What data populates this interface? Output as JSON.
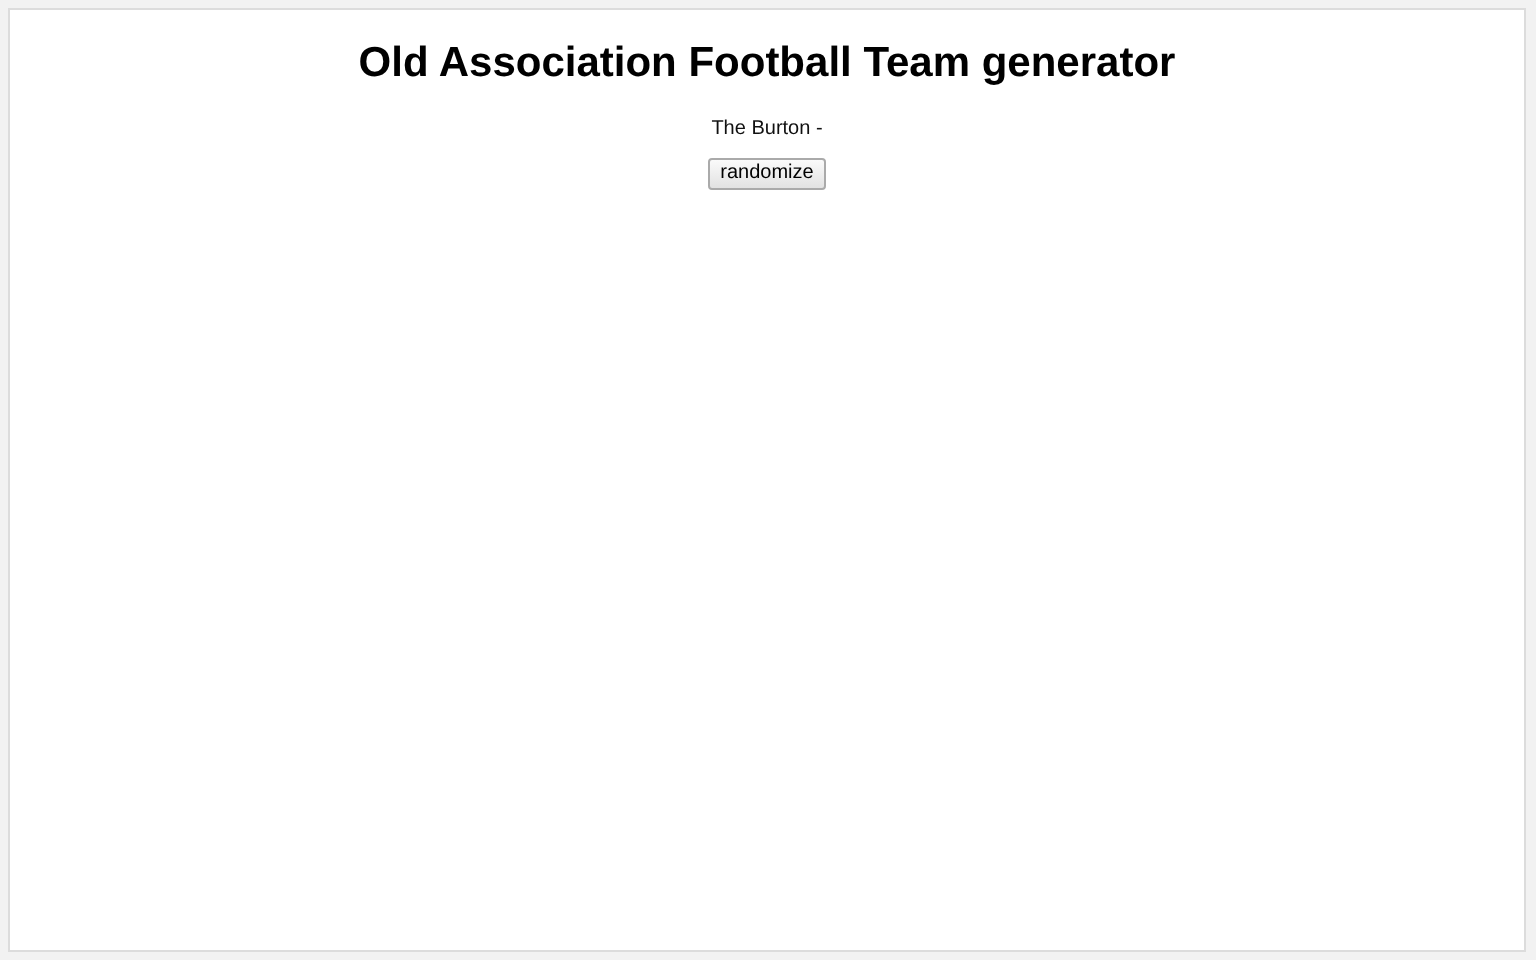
{
  "title": "Old Association Football Team generator",
  "result": "The Burton -",
  "button": "randomize"
}
